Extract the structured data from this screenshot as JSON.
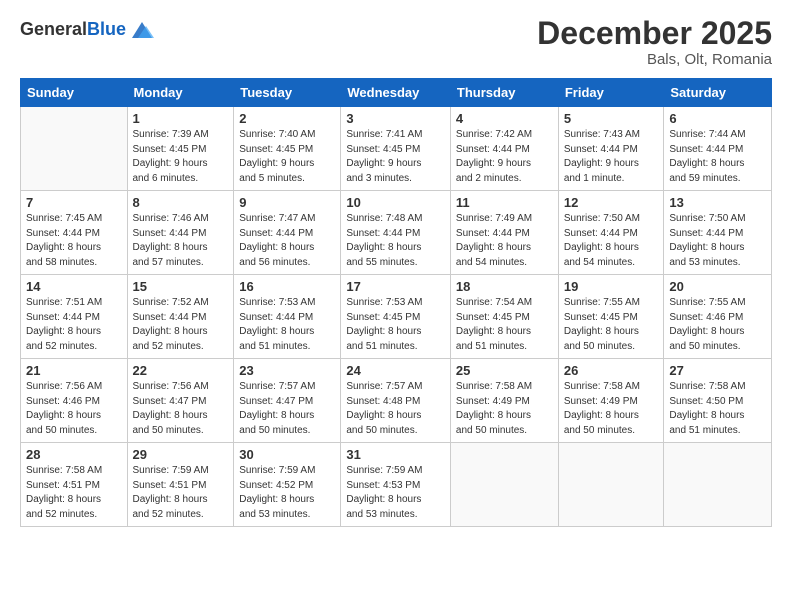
{
  "logo": {
    "general": "General",
    "blue": "Blue"
  },
  "header": {
    "month": "December 2025",
    "location": "Bals, Olt, Romania"
  },
  "days_of_week": [
    "Sunday",
    "Monday",
    "Tuesday",
    "Wednesday",
    "Thursday",
    "Friday",
    "Saturday"
  ],
  "weeks": [
    [
      {
        "day": "",
        "info": ""
      },
      {
        "day": "1",
        "info": "Sunrise: 7:39 AM\nSunset: 4:45 PM\nDaylight: 9 hours\nand 6 minutes."
      },
      {
        "day": "2",
        "info": "Sunrise: 7:40 AM\nSunset: 4:45 PM\nDaylight: 9 hours\nand 5 minutes."
      },
      {
        "day": "3",
        "info": "Sunrise: 7:41 AM\nSunset: 4:45 PM\nDaylight: 9 hours\nand 3 minutes."
      },
      {
        "day": "4",
        "info": "Sunrise: 7:42 AM\nSunset: 4:44 PM\nDaylight: 9 hours\nand 2 minutes."
      },
      {
        "day": "5",
        "info": "Sunrise: 7:43 AM\nSunset: 4:44 PM\nDaylight: 9 hours\nand 1 minute."
      },
      {
        "day": "6",
        "info": "Sunrise: 7:44 AM\nSunset: 4:44 PM\nDaylight: 8 hours\nand 59 minutes."
      }
    ],
    [
      {
        "day": "7",
        "info": "Sunrise: 7:45 AM\nSunset: 4:44 PM\nDaylight: 8 hours\nand 58 minutes."
      },
      {
        "day": "8",
        "info": "Sunrise: 7:46 AM\nSunset: 4:44 PM\nDaylight: 8 hours\nand 57 minutes."
      },
      {
        "day": "9",
        "info": "Sunrise: 7:47 AM\nSunset: 4:44 PM\nDaylight: 8 hours\nand 56 minutes."
      },
      {
        "day": "10",
        "info": "Sunrise: 7:48 AM\nSunset: 4:44 PM\nDaylight: 8 hours\nand 55 minutes."
      },
      {
        "day": "11",
        "info": "Sunrise: 7:49 AM\nSunset: 4:44 PM\nDaylight: 8 hours\nand 54 minutes."
      },
      {
        "day": "12",
        "info": "Sunrise: 7:50 AM\nSunset: 4:44 PM\nDaylight: 8 hours\nand 54 minutes."
      },
      {
        "day": "13",
        "info": "Sunrise: 7:50 AM\nSunset: 4:44 PM\nDaylight: 8 hours\nand 53 minutes."
      }
    ],
    [
      {
        "day": "14",
        "info": "Sunrise: 7:51 AM\nSunset: 4:44 PM\nDaylight: 8 hours\nand 52 minutes."
      },
      {
        "day": "15",
        "info": "Sunrise: 7:52 AM\nSunset: 4:44 PM\nDaylight: 8 hours\nand 52 minutes."
      },
      {
        "day": "16",
        "info": "Sunrise: 7:53 AM\nSunset: 4:44 PM\nDaylight: 8 hours\nand 51 minutes."
      },
      {
        "day": "17",
        "info": "Sunrise: 7:53 AM\nSunset: 4:45 PM\nDaylight: 8 hours\nand 51 minutes."
      },
      {
        "day": "18",
        "info": "Sunrise: 7:54 AM\nSunset: 4:45 PM\nDaylight: 8 hours\nand 51 minutes."
      },
      {
        "day": "19",
        "info": "Sunrise: 7:55 AM\nSunset: 4:45 PM\nDaylight: 8 hours\nand 50 minutes."
      },
      {
        "day": "20",
        "info": "Sunrise: 7:55 AM\nSunset: 4:46 PM\nDaylight: 8 hours\nand 50 minutes."
      }
    ],
    [
      {
        "day": "21",
        "info": "Sunrise: 7:56 AM\nSunset: 4:46 PM\nDaylight: 8 hours\nand 50 minutes."
      },
      {
        "day": "22",
        "info": "Sunrise: 7:56 AM\nSunset: 4:47 PM\nDaylight: 8 hours\nand 50 minutes."
      },
      {
        "day": "23",
        "info": "Sunrise: 7:57 AM\nSunset: 4:47 PM\nDaylight: 8 hours\nand 50 minutes."
      },
      {
        "day": "24",
        "info": "Sunrise: 7:57 AM\nSunset: 4:48 PM\nDaylight: 8 hours\nand 50 minutes."
      },
      {
        "day": "25",
        "info": "Sunrise: 7:58 AM\nSunset: 4:49 PM\nDaylight: 8 hours\nand 50 minutes."
      },
      {
        "day": "26",
        "info": "Sunrise: 7:58 AM\nSunset: 4:49 PM\nDaylight: 8 hours\nand 50 minutes."
      },
      {
        "day": "27",
        "info": "Sunrise: 7:58 AM\nSunset: 4:50 PM\nDaylight: 8 hours\nand 51 minutes."
      }
    ],
    [
      {
        "day": "28",
        "info": "Sunrise: 7:58 AM\nSunset: 4:51 PM\nDaylight: 8 hours\nand 52 minutes."
      },
      {
        "day": "29",
        "info": "Sunrise: 7:59 AM\nSunset: 4:51 PM\nDaylight: 8 hours\nand 52 minutes."
      },
      {
        "day": "30",
        "info": "Sunrise: 7:59 AM\nSunset: 4:52 PM\nDaylight: 8 hours\nand 53 minutes."
      },
      {
        "day": "31",
        "info": "Sunrise: 7:59 AM\nSunset: 4:53 PM\nDaylight: 8 hours\nand 53 minutes."
      },
      {
        "day": "",
        "info": ""
      },
      {
        "day": "",
        "info": ""
      },
      {
        "day": "",
        "info": ""
      }
    ]
  ]
}
